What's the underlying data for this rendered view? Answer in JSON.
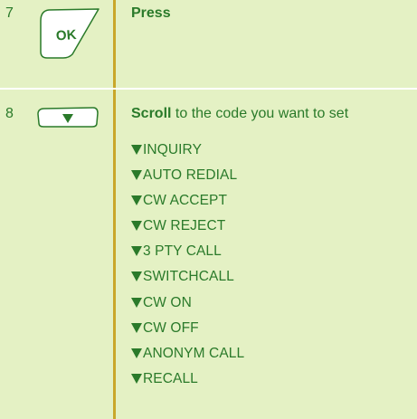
{
  "steps": [
    {
      "number": "7",
      "key": {
        "icon": "ok-key-icon",
        "label": "OK"
      },
      "instruction_bold": "Press",
      "instruction_rest": ""
    },
    {
      "number": "8",
      "key": {
        "icon": "scroll-down-key-icon",
        "label": ""
      },
      "instruction_bold": "Scroll",
      "instruction_rest": " to the code you want to set"
    }
  ],
  "codes": [
    "INQUIRY",
    "AUTO REDIAL",
    "CW ACCEPT",
    "CW REJECT",
    "3 PTY CALL",
    "SWITCHCALL",
    "CW ON",
    "CW OFF",
    "ANONYM CALL",
    "RECALL"
  ],
  "colors": {
    "background": "#e4f1c4",
    "text": "#2a7a2a",
    "divider": "#c9a72a",
    "separator": "#ffffff"
  }
}
